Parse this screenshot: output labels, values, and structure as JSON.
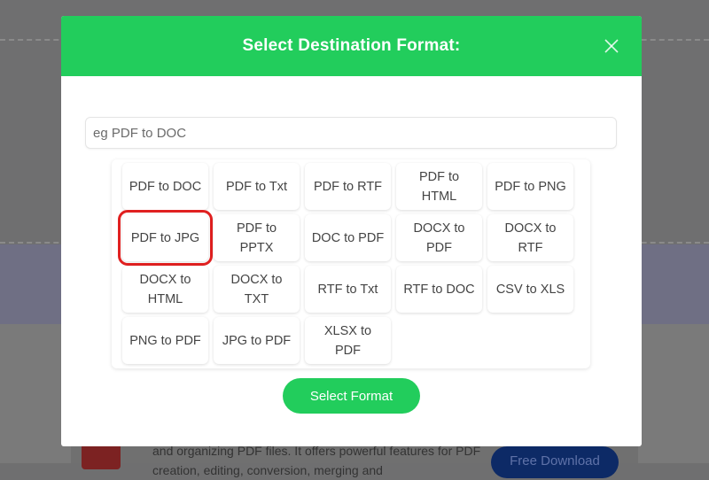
{
  "background": {
    "paragraph": "and organizing PDF files. It offers powerful features for PDF creation, editing, conversion, merging and",
    "download_button": "Free Download"
  },
  "modal": {
    "title": "Select Destination Format:",
    "search": {
      "placeholder": "eg PDF to DOC",
      "value": ""
    },
    "options": [
      "PDF to DOC",
      "PDF to Txt",
      "PDF to RTF",
      "PDF to HTML",
      "PDF to PNG",
      "PDF to JPG",
      "PDF to PPTX",
      "DOC to PDF",
      "DOCX to PDF",
      "DOCX to RTF",
      "DOCX to HTML",
      "DOCX to TXT",
      "RTF to Txt",
      "RTF to DOC",
      "CSV to XLS",
      "PNG to PDF",
      "JPG to PDF",
      "XLSX to PDF"
    ],
    "highlighted_option": "PDF to JPG",
    "select_button": "Select Format"
  },
  "colors": {
    "accent_green": "#22cd5c",
    "highlight_red": "#e02020"
  }
}
